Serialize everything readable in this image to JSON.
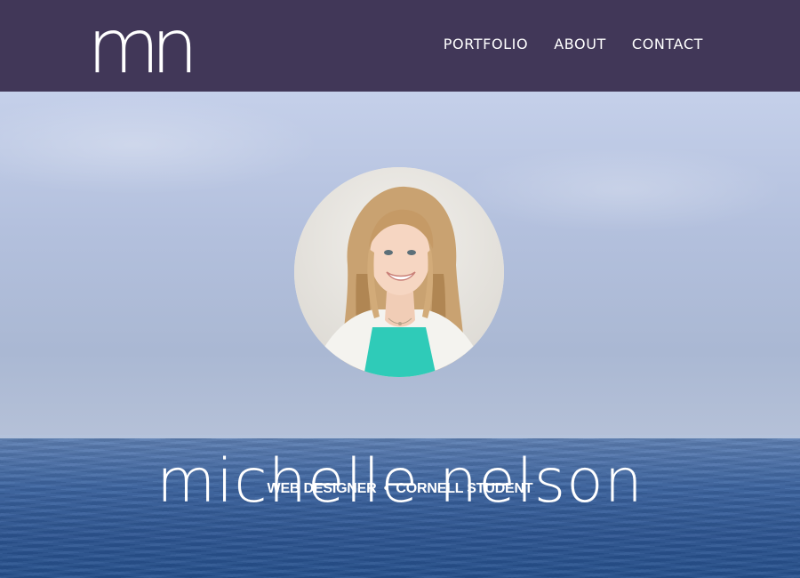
{
  "brand": {
    "logo_text": "mn"
  },
  "nav": {
    "items": [
      {
        "label": "PORTFOLIO"
      },
      {
        "label": "ABOUT"
      },
      {
        "label": "CONTACT"
      }
    ]
  },
  "hero": {
    "name": "michelle nelson",
    "tagline_left": "WEB DESIGNER",
    "tagline_separator": "•",
    "tagline_right": "CORNELL STUDENT"
  },
  "colors": {
    "header_bg": "#413758",
    "text": "#ffffff",
    "sky": "#b3c0dd",
    "sea": "#2d5592"
  }
}
